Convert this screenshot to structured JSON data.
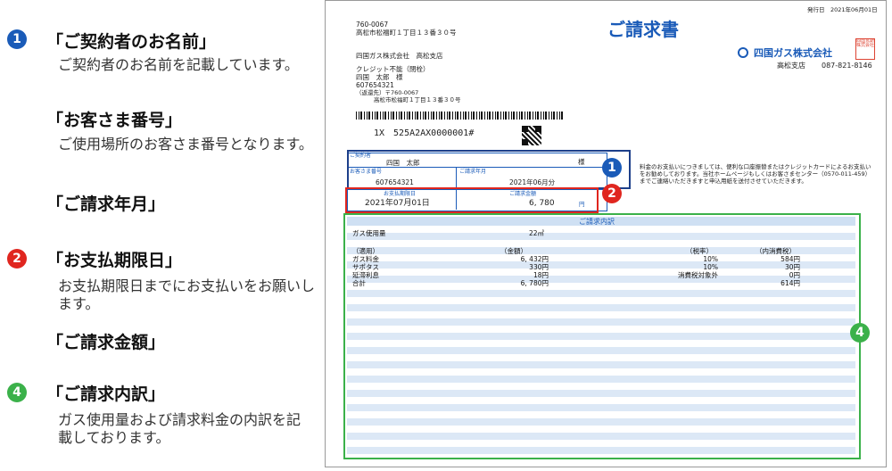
{
  "legend": {
    "item1": {
      "marker": "1",
      "heading": "「ご契約者のお名前」",
      "desc": "ご契約者のお名前を記載しています。"
    },
    "item_customer_no": {
      "heading": "「お客さま番号」",
      "desc": "ご使用場所のお客さま番号となります。"
    },
    "item_billing_month": {
      "heading": "「ご請求年月」"
    },
    "item2": {
      "marker": "2",
      "heading": "「お支払期限日」",
      "desc": "お支払期限日までにお支払いをお願いします。"
    },
    "item_amount": {
      "heading": "「ご請求金額」"
    },
    "item4": {
      "marker": "4",
      "heading": "「ご請求内訳」",
      "desc": "ガス使用量および請求料金の内訳を記載しております。"
    }
  },
  "invoice": {
    "issue_date": "発行日　2021年06月01日",
    "postal_code": "760-0067",
    "address": "高松市松福町１丁目１３番３０号",
    "sender": "四国ガス株式会社　高松支店",
    "title": "ご請求書",
    "stamp_text": "四国瓦斯株式会社",
    "logo_text": "四国ガス株式会社",
    "branch": "高松支店",
    "branch_phone": "087-821-8146",
    "recipient_note": "クレジット不能（閉栓）",
    "recipient_name": "四国　太郎　様",
    "recipient_no": "607654321",
    "return_label": "（返還先）〒760-0067",
    "return_address": "高松市松福町１丁目１３番３０号",
    "mail_code": "1X　525A2AX0000001#",
    "contract_label": "ご契約者",
    "contract_name": "四国　太郎",
    "contract_suffix": "様",
    "customer_no_label": "お客さま番号",
    "customer_no": "607654321",
    "billing_month_label": "ご請求年月",
    "billing_month": "2021年06月分",
    "due_date_label": "お支払期限日",
    "due_date": "2021年07月01日",
    "amount_label": "ご請求金額",
    "amount": "6, 780",
    "amount_unit": "円",
    "notice": "料金のお支払いにつきましては、便利な口座振替またはクレジットカードによるお支払いをお勧めしております。当社ホームページもしくはお客さまセンター（0570-011-459）までご連絡いただきますと申込用紙を送付させていただきます。",
    "markers": {
      "m1": "1",
      "m2": "2",
      "m4": "4"
    },
    "detail": {
      "title": "ご請求内訳",
      "usage_label": "ガス使用量",
      "usage_value": "22㎥",
      "headers": [
        "（適用）",
        "（金額）",
        "（税率）",
        "（内消費税）"
      ],
      "rows": [
        [
          "ガス料金",
          "6, 432円",
          "10%",
          "584円"
        ],
        [
          "サポタス",
          "330円",
          "10%",
          "30円"
        ],
        [
          "延滞利息",
          "18円",
          "消費税対象外",
          "0円"
        ],
        [
          "合計",
          "6, 780円",
          "",
          "614円"
        ]
      ]
    }
  },
  "colors": {
    "marker_blue": "#1a5bb8",
    "marker_red": "#e0261f",
    "marker_green": "#3bb14a",
    "stripe": "#dce8f6"
  }
}
